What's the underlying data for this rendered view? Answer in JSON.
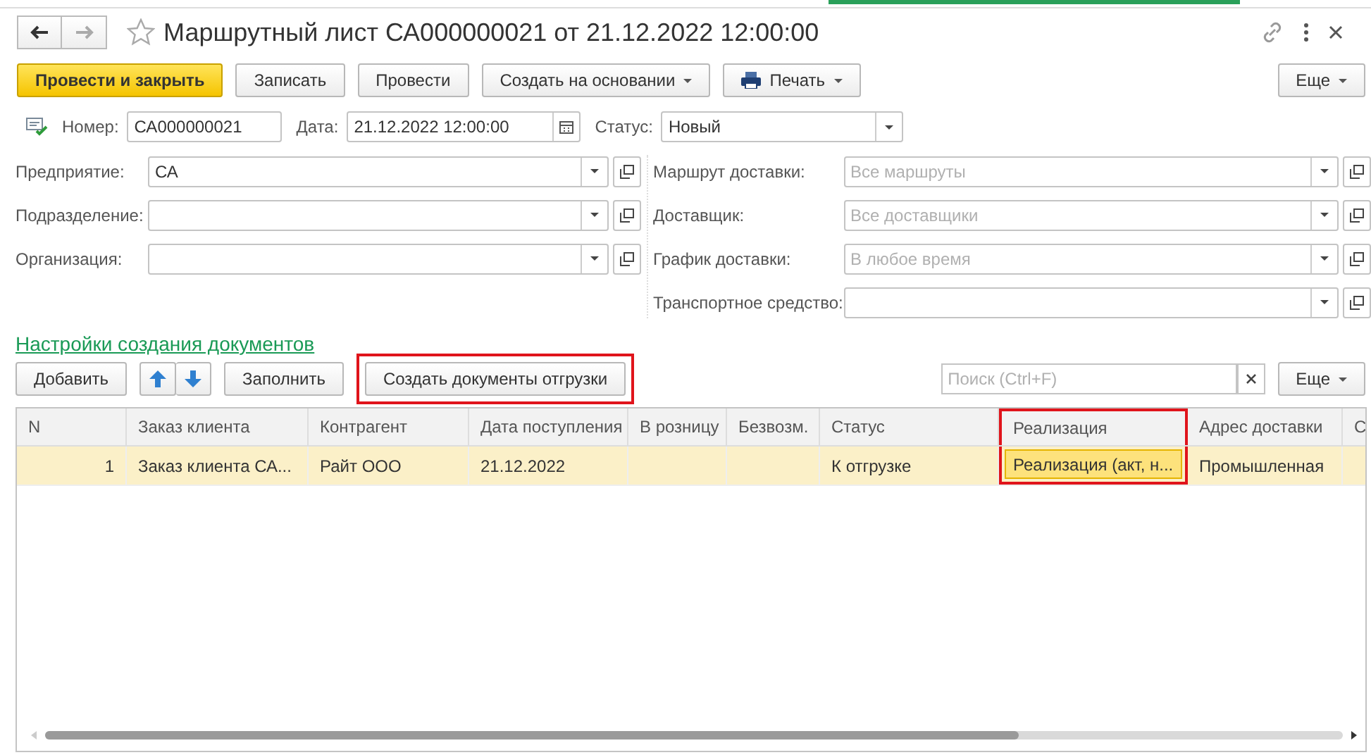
{
  "window": {
    "title": "Маршрутный лист СА000000021 от 21.12.2022 12:00:00",
    "favorite": false
  },
  "toolbar": [
    {
      "label": "Провести и закрыть",
      "kind": "primary",
      "dropdown": false
    },
    {
      "label": "Записать",
      "kind": "plain",
      "dropdown": false
    },
    {
      "label": "Провести",
      "kind": "plain",
      "dropdown": false
    },
    {
      "label": "Создать на основании",
      "kind": "plain",
      "dropdown": true
    },
    {
      "label": "Печать",
      "kind": "print",
      "dropdown": true
    }
  ],
  "more_button": "Еще",
  "header_fields": {
    "number_label": "Номер:",
    "number": "СА000000021",
    "date_label": "Дата:",
    "date": "21.12.2022 12:00:00",
    "status_label": "Статус:",
    "status": "Новый"
  },
  "left_fields": [
    {
      "label": "Предприятие:",
      "value": "СА"
    },
    {
      "label": "Подразделение:"
    },
    {
      "label": "Организация:"
    }
  ],
  "right_fields": [
    {
      "label": "Маршрут доставки:",
      "placeholder": "Все маршруты"
    },
    {
      "label": "Доставщик:",
      "placeholder": "Все доставщики"
    },
    {
      "label": "График доставки:",
      "placeholder": "В любое время"
    },
    {
      "label": "Транспортное средство:"
    }
  ],
  "settings_link": "Настройки создания документов",
  "table_toolbar": [
    {
      "label": "Добавить",
      "kind": "button",
      "highlighted": false
    },
    {
      "kind": "move-up"
    },
    {
      "kind": "move-down"
    },
    {
      "label": "Заполнить",
      "kind": "button",
      "highlighted": false
    },
    {
      "label": "Создать документы отгрузки",
      "kind": "button",
      "highlighted": true
    }
  ],
  "search": {
    "placeholder": "Поиск (Ctrl+F)"
  },
  "table_more": "Еще",
  "table": {
    "columns": [
      {
        "label": "N",
        "highlighted": false
      },
      {
        "label": "Заказ клиента",
        "highlighted": false
      },
      {
        "label": "Контрагент",
        "highlighted": false
      },
      {
        "label": "Дата поступления",
        "highlighted": false
      },
      {
        "label": "В розницу",
        "highlighted": false
      },
      {
        "label": "Безвозм.",
        "highlighted": false
      },
      {
        "label": "Статус",
        "highlighted": false
      },
      {
        "label": "Реализация",
        "highlighted": true
      },
      {
        "label": "Адрес доставки",
        "highlighted": false
      },
      {
        "label": "С",
        "highlighted": false
      }
    ],
    "rows": [
      {
        "selected": true,
        "cells": [
          {
            "text": "1",
            "current": false
          },
          {
            "text": "Заказ клиента СА...",
            "current": false
          },
          {
            "text": "Райт ООО",
            "current": false
          },
          {
            "text": "21.12.2022",
            "current": false
          },
          {
            "current": false
          },
          {
            "current": false
          },
          {
            "text": "К отгрузке",
            "current": false
          },
          {
            "text": "Реализация (акт, н...",
            "current": true
          },
          {
            "text": "Промышленная",
            "current": false
          }
        ]
      }
    ]
  }
}
